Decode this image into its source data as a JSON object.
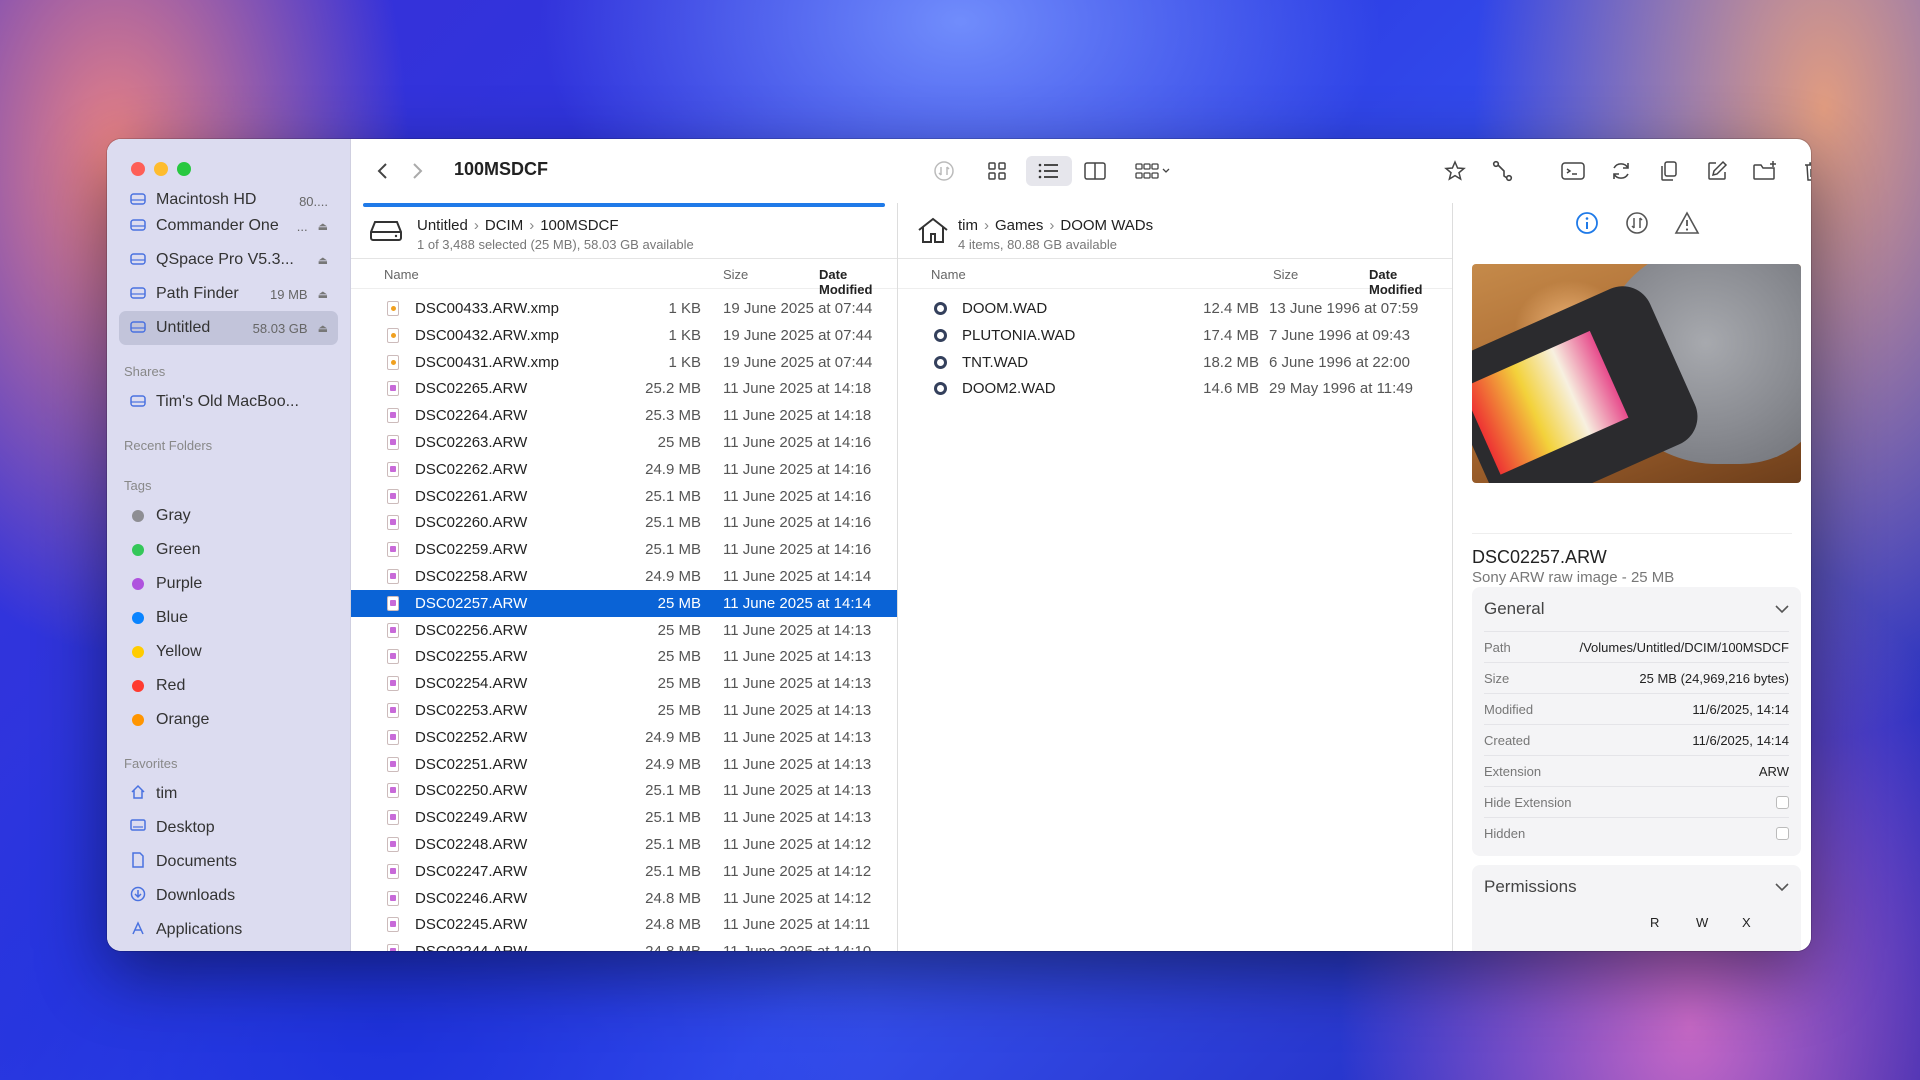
{
  "sidebar": {
    "volumes": [
      {
        "label": "Macintosh HD",
        "meta": "80...."
      },
      {
        "label": "Commander One",
        "meta": "..."
      },
      {
        "label": "QSpace Pro V5.3...",
        "meta": ""
      },
      {
        "label": "Path Finder",
        "meta": "19 MB"
      },
      {
        "label": "Untitled",
        "meta": "58.03 GB"
      }
    ],
    "shares_heading": "Shares",
    "shares": [
      {
        "label": "Tim's Old MacBoo..."
      }
    ],
    "recent_heading": "Recent Folders",
    "tags_heading": "Tags",
    "tags": [
      {
        "label": "Gray",
        "color": "#8e8e93"
      },
      {
        "label": "Green",
        "color": "#34c759"
      },
      {
        "label": "Purple",
        "color": "#af52de"
      },
      {
        "label": "Blue",
        "color": "#0a84ff"
      },
      {
        "label": "Yellow",
        "color": "#ffcc00"
      },
      {
        "label": "Red",
        "color": "#ff3b30"
      },
      {
        "label": "Orange",
        "color": "#ff9500"
      }
    ],
    "favorites_heading": "Favorites",
    "favorites": [
      {
        "label": "tim",
        "icon": "house-icon"
      },
      {
        "label": "Desktop",
        "icon": "desktop-icon"
      },
      {
        "label": "Documents",
        "icon": "document-icon"
      },
      {
        "label": "Downloads",
        "icon": "download-icon"
      },
      {
        "label": "Applications",
        "icon": "applications-icon"
      }
    ]
  },
  "toolbar": {
    "title": "100MSDCF"
  },
  "left_pane": {
    "path": [
      "Untitled",
      "DCIM",
      "100MSDCF"
    ],
    "status": "1 of 3,488 selected (25 MB), 58.03 GB available",
    "columns": {
      "name": "Name",
      "size": "Size",
      "date": "Date Modified"
    },
    "files": [
      {
        "name": "DSC00433.ARW.xmp",
        "size": "1 KB",
        "date": "19 June 2025 at 07:44",
        "kind": "xmp"
      },
      {
        "name": "DSC00432.ARW.xmp",
        "size": "1 KB",
        "date": "19 June 2025 at 07:44",
        "kind": "xmp"
      },
      {
        "name": "DSC00431.ARW.xmp",
        "size": "1 KB",
        "date": "19 June 2025 at 07:44",
        "kind": "xmp"
      },
      {
        "name": "DSC02265.ARW",
        "size": "25.2 MB",
        "date": "11 June 2025 at 14:18",
        "kind": "raw"
      },
      {
        "name": "DSC02264.ARW",
        "size": "25.3 MB",
        "date": "11 June 2025 at 14:18",
        "kind": "raw"
      },
      {
        "name": "DSC02263.ARW",
        "size": "25 MB",
        "date": "11 June 2025 at 14:16",
        "kind": "raw"
      },
      {
        "name": "DSC02262.ARW",
        "size": "24.9 MB",
        "date": "11 June 2025 at 14:16",
        "kind": "raw"
      },
      {
        "name": "DSC02261.ARW",
        "size": "25.1 MB",
        "date": "11 June 2025 at 14:16",
        "kind": "raw"
      },
      {
        "name": "DSC02260.ARW",
        "size": "25.1 MB",
        "date": "11 June 2025 at 14:16",
        "kind": "raw"
      },
      {
        "name": "DSC02259.ARW",
        "size": "25.1 MB",
        "date": "11 June 2025 at 14:16",
        "kind": "raw"
      },
      {
        "name": "DSC02258.ARW",
        "size": "24.9 MB",
        "date": "11 June 2025 at 14:14",
        "kind": "raw"
      },
      {
        "name": "DSC02257.ARW",
        "size": "25 MB",
        "date": "11 June 2025 at 14:14",
        "kind": "raw",
        "selected": true
      },
      {
        "name": "DSC02256.ARW",
        "size": "25 MB",
        "date": "11 June 2025 at 14:13",
        "kind": "raw"
      },
      {
        "name": "DSC02255.ARW",
        "size": "25 MB",
        "date": "11 June 2025 at 14:13",
        "kind": "raw"
      },
      {
        "name": "DSC02254.ARW",
        "size": "25 MB",
        "date": "11 June 2025 at 14:13",
        "kind": "raw"
      },
      {
        "name": "DSC02253.ARW",
        "size": "25 MB",
        "date": "11 June 2025 at 14:13",
        "kind": "raw"
      },
      {
        "name": "DSC02252.ARW",
        "size": "24.9 MB",
        "date": "11 June 2025 at 14:13",
        "kind": "raw"
      },
      {
        "name": "DSC02251.ARW",
        "size": "24.9 MB",
        "date": "11 June 2025 at 14:13",
        "kind": "raw"
      },
      {
        "name": "DSC02250.ARW",
        "size": "25.1 MB",
        "date": "11 June 2025 at 14:13",
        "kind": "raw"
      },
      {
        "name": "DSC02249.ARW",
        "size": "25.1 MB",
        "date": "11 June 2025 at 14:13",
        "kind": "raw"
      },
      {
        "name": "DSC02248.ARW",
        "size": "25.1 MB",
        "date": "11 June 2025 at 14:12",
        "kind": "raw"
      },
      {
        "name": "DSC02247.ARW",
        "size": "25.1 MB",
        "date": "11 June 2025 at 14:12",
        "kind": "raw"
      },
      {
        "name": "DSC02246.ARW",
        "size": "24.8 MB",
        "date": "11 June 2025 at 14:12",
        "kind": "raw"
      },
      {
        "name": "DSC02245.ARW",
        "size": "24.8 MB",
        "date": "11 June 2025 at 14:11",
        "kind": "raw"
      },
      {
        "name": "DSC02244.ARW",
        "size": "24.8 MB",
        "date": "11 June 2025 at 14:10",
        "kind": "raw"
      }
    ]
  },
  "right_pane": {
    "path": [
      "tim",
      "Games",
      "DOOM WADs"
    ],
    "status": "4 items, 80.88 GB available",
    "columns": {
      "name": "Name",
      "size": "Size",
      "date": "Date Modified"
    },
    "files": [
      {
        "name": "DOOM.WAD",
        "size": "12.4 MB",
        "date": "13 June 1996 at 07:59",
        "kind": "wad"
      },
      {
        "name": "PLUTONIA.WAD",
        "size": "17.4 MB",
        "date": "7 June 1996 at 09:43",
        "kind": "wad"
      },
      {
        "name": "TNT.WAD",
        "size": "18.2 MB",
        "date": "6 June 1996 at 22:00",
        "kind": "wad"
      },
      {
        "name": "DOOM2.WAD",
        "size": "14.6 MB",
        "date": "29 May 1996 at 11:49",
        "kind": "wad"
      }
    ]
  },
  "inspector": {
    "name": "DSC02257.ARW",
    "kind": "Sony ARW raw image - 25 MB",
    "general": {
      "title": "General",
      "rows": [
        {
          "key": "Path",
          "value": "/Volumes/Untitled/DCIM/100MSDCF"
        },
        {
          "key": "Size",
          "value": "25 MB (24,969,216 bytes)"
        },
        {
          "key": "Modified",
          "value": "11/6/2025, 14:14"
        },
        {
          "key": "Created",
          "value": "11/6/2025, 14:14"
        },
        {
          "key": "Extension",
          "value": "ARW"
        }
      ],
      "checks": [
        {
          "key": "Hide Extension",
          "checked": false
        },
        {
          "key": "Hidden",
          "checked": false
        }
      ]
    },
    "permissions": {
      "title": "Permissions",
      "headers": [
        "R",
        "W",
        "X"
      ]
    }
  }
}
